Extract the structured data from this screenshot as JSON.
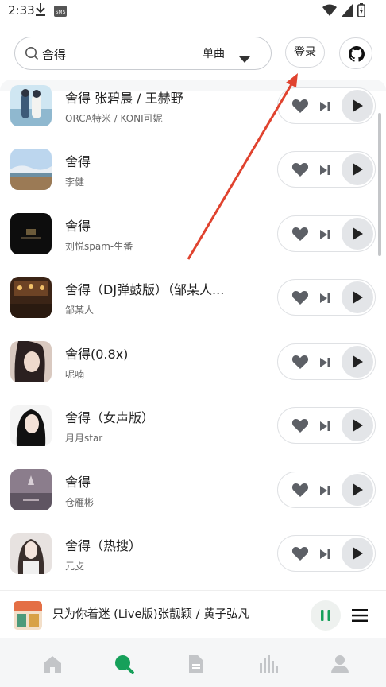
{
  "status_bar": {
    "time": "2:33",
    "sms_badge": "SMS",
    "icons": [
      "download-icon",
      "sms-icon",
      "wifi-icon",
      "signal-icon",
      "battery-icon"
    ]
  },
  "header": {
    "search_value": "舍得",
    "search_type": "单曲",
    "login_label": "登录",
    "github_icon": "github-icon"
  },
  "songs": [
    {
      "title": "舍得 张碧晨 / 王赫野",
      "artist": "ORCA特米 / KONI可妮"
    },
    {
      "title": "舍得",
      "artist": "李健"
    },
    {
      "title": "舍得",
      "artist": "刘悦spam-生番"
    },
    {
      "title": "舍得（DJ弹鼓版）（邹某人...",
      "artist": "邹某人"
    },
    {
      "title": "舍得(0.8x)",
      "artist": "呢喃"
    },
    {
      "title": "舍得（女声版）",
      "artist": "月月star"
    },
    {
      "title": "舍得",
      "artist": "仓雁彬"
    },
    {
      "title": "舍得（热搜）",
      "artist": "元攴"
    }
  ],
  "player": {
    "now_playing": "只为你着迷 (Live版)张靓颖 / 黄子弘凡",
    "state": "playing"
  },
  "tabs": [
    "home-icon",
    "search-icon",
    "document-icon",
    "chart-icon",
    "profile-icon"
  ],
  "colors": {
    "accent": "#16a05a",
    "annotation_arrow": "#e0432f",
    "tab_inactive": "#c3c5c8",
    "play_button_bg": "#e3e5e8"
  }
}
